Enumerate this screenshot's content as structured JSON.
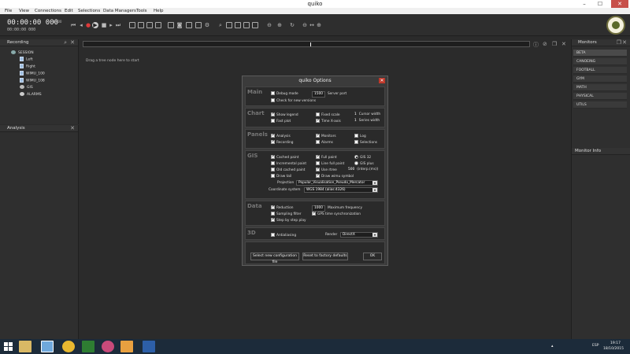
{
  "window": {
    "title": "quiko",
    "minimize": "–",
    "maximize": "☐",
    "close": "✕"
  },
  "menu": [
    "File",
    "View",
    "Connections",
    "Edit",
    "Selections",
    "Data Managers",
    "Tools",
    "Help"
  ],
  "toolbar": {
    "time_main": "00:00:00 000",
    "time_sub": "00:00:00 000",
    "rate": "1.000"
  },
  "recording_panel": {
    "title": "Recording",
    "items": [
      "SESSION",
      "Left",
      "Right",
      "WIMU_100",
      "WIMU_108",
      "GIS",
      "ALARMS"
    ]
  },
  "analysis_panel": {
    "title": "Analysis"
  },
  "main": {
    "hint": "Drag a tree node here to start"
  },
  "monitors_panel": {
    "title": "Monitors",
    "items": [
      "BETA",
      "CANOEING",
      "FOOTBALL",
      "GYM",
      "MATH",
      "PHYSICAL",
      "UTILS"
    ]
  },
  "monitor_info": {
    "title": "Monitor Info"
  },
  "dialog": {
    "title": "quiko Options",
    "main": {
      "label": "Main",
      "debug": "Debug mode",
      "port_value": "1500",
      "port_label": "Server port",
      "check_versions": "Check for new versions"
    },
    "chart": {
      "label": "Chart",
      "show_legend": "Show legend",
      "fixed_scale": "Fixed scale",
      "cursor_value": "1",
      "cursor_label": "Cursor width",
      "fast_plot": "Fast plot",
      "time_x": "Time X-axis",
      "series_value": "1",
      "series_label": "Series width"
    },
    "panels": {
      "label": "Panels",
      "analysis": "Analysis",
      "monitors": "Monitors",
      "log": "Log",
      "recording": "Recording",
      "alarms": "Alarms",
      "selections": "Selections"
    },
    "gis": {
      "label": "GIS",
      "cached_paint": "Cached paint",
      "full_paint": "Full paint",
      "gis_32": "GIS 32",
      "incremental": "Incremental paint",
      "line_full": "Line full paint",
      "gis_plus": "GIS plus",
      "old_cached": "Old cached paint",
      "use_rtree": "Use rtree",
      "interp_value": "500",
      "interp_label": "(interp.(ms))",
      "draw_tail": "Draw tail",
      "draw_wimu": "Draw wimu symbol",
      "projection_label": "Projection",
      "projection_value": "Popular_Visualisation_Pseudo_Mercator",
      "coord_label": "Coordinate system",
      "coord_value": "WGS 1984 (alias:4326)"
    },
    "data": {
      "label": "Data",
      "reduction": "Reduction",
      "freq_value": "1000",
      "freq_label": "Maximum frequency",
      "sampling": "Sampling filter",
      "gps_sync": "GPS time synchronization",
      "step": "Step by step play"
    },
    "d3": {
      "label": "3D",
      "antialiasing": "Antialiasing",
      "render_label": "Render",
      "render_value": "DirectX"
    },
    "buttons": {
      "select_config": "Select new configuration file",
      "reset": "Reset to factory defaults",
      "ok": "OK"
    }
  },
  "taskbar": {
    "lang": "ESP",
    "time": "19:17",
    "date": "18/10/2015"
  }
}
